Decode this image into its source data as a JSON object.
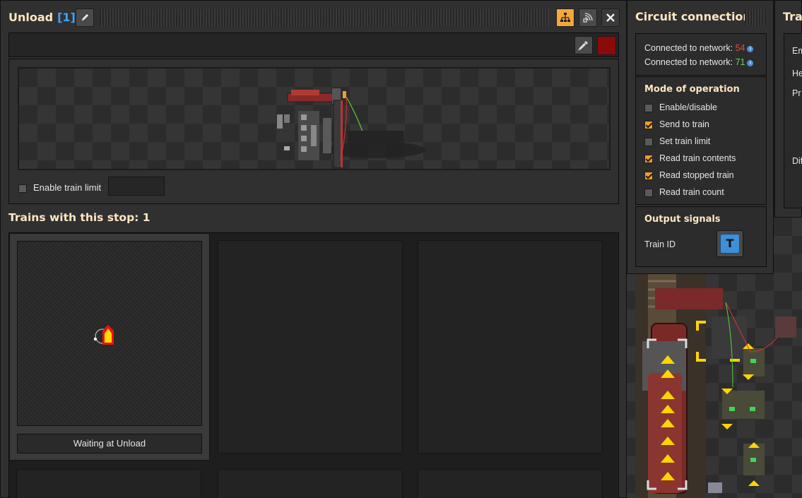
{
  "station": {
    "name": "Unload",
    "count": "[1]",
    "enable_limit_label": "Enable train limit",
    "enable_limit_checked": false,
    "limit_value": "",
    "color": "#8a0b0b"
  },
  "trains": {
    "heading": "Trains with this stop: 1",
    "cards": [
      {
        "status": "Waiting at Unload"
      }
    ]
  },
  "circuit": {
    "title": "Circuit connection",
    "connected_label": "Connected to network:",
    "network_red": "54",
    "network_green": "71",
    "mode_title": "Mode of operation",
    "modes": [
      {
        "label": "Enable/disable",
        "checked": false
      },
      {
        "label": "Send to train",
        "checked": true
      },
      {
        "label": "Set train limit",
        "checked": false
      },
      {
        "label": "Read train contents",
        "checked": true
      },
      {
        "label": "Read stopped train",
        "checked": true
      },
      {
        "label": "Read train count",
        "checked": false
      }
    ],
    "output_title": "Output signals",
    "output_label": "Train ID",
    "output_signal": "T"
  },
  "right_panel": {
    "title": "Tra",
    "rows": [
      "Em",
      "He",
      "Pr",
      "Dif"
    ]
  },
  "colors": {
    "accent_orange": "#f4a73a",
    "heading_cream": "#ffe6c0",
    "count_blue": "#3aa5ff",
    "wire_red": "#e84a3a",
    "wire_green": "#6bd15b"
  }
}
